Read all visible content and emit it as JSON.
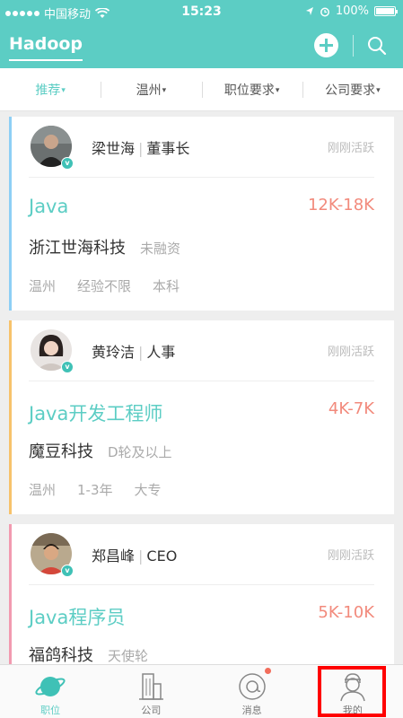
{
  "status_bar": {
    "carrier": "中国移动",
    "time": "15:23",
    "battery": "100%"
  },
  "nav": {
    "title": "Hadoop",
    "add_icon": "plus-circle-icon",
    "search_icon": "search-icon"
  },
  "filters": [
    {
      "label": "推荐"
    },
    {
      "label": "温州"
    },
    {
      "label": "职位要求"
    },
    {
      "label": "公司要求"
    }
  ],
  "jobs": [
    {
      "recruiter_name": "梁世海",
      "recruiter_role": "董事长",
      "activity": "刚刚活跃",
      "title": "Java",
      "salary": "12K-18K",
      "company": "浙江世海科技",
      "funding": "未融资",
      "city": "温州",
      "experience": "经验不限",
      "education": "本科",
      "accent": "#8ecff5"
    },
    {
      "recruiter_name": "黄玲洁",
      "recruiter_role": "人事",
      "activity": "刚刚活跃",
      "title": "Java开发工程师",
      "salary": "4K-7K",
      "company": "魔豆科技",
      "funding": "D轮及以上",
      "city": "温州",
      "experience": "1-3年",
      "education": "大专",
      "accent": "#f7c26b"
    },
    {
      "recruiter_name": "郑昌峰",
      "recruiter_role": "CEO",
      "activity": "刚刚活跃",
      "title": "Java程序员",
      "salary": "5K-10K",
      "company": "福鸽科技",
      "funding": "天使轮",
      "accent": "#f29ab0"
    }
  ],
  "tabs": [
    {
      "label": "职位",
      "icon": "planet-icon"
    },
    {
      "label": "公司",
      "icon": "building-icon"
    },
    {
      "label": "消息",
      "icon": "message-icon"
    },
    {
      "label": "我的",
      "icon": "user-icon"
    }
  ],
  "colors": {
    "brand": "#5ccdc4",
    "salary": "#f28a7c",
    "highlight": "#ff0000"
  }
}
